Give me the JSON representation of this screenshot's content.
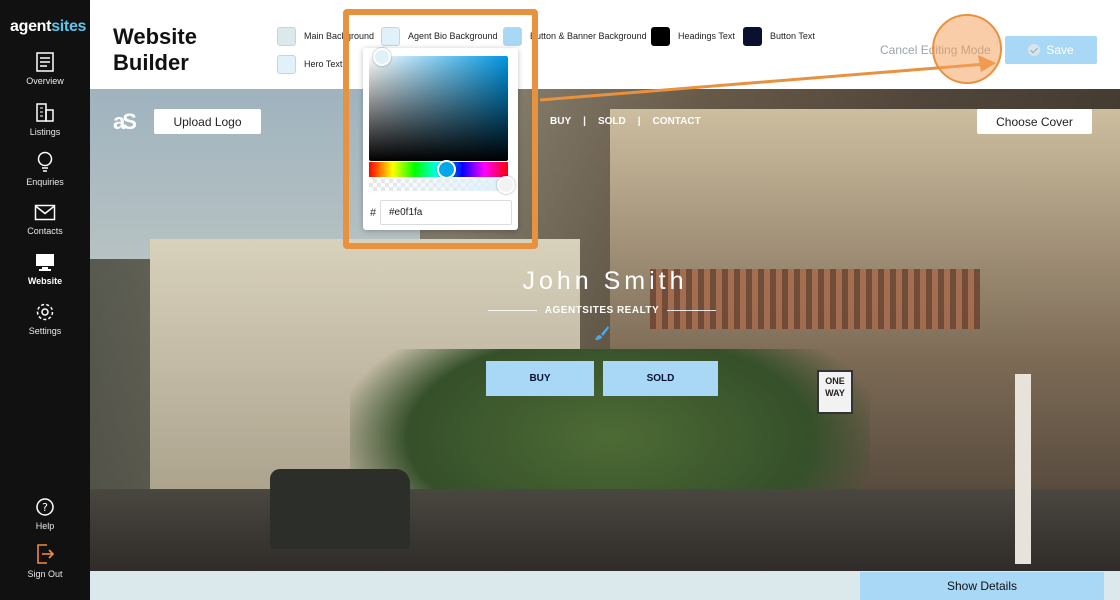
{
  "brand": {
    "part1": "agent",
    "part2": "sites"
  },
  "sidebar": {
    "items": [
      {
        "label": "Overview"
      },
      {
        "label": "Listings"
      },
      {
        "label": "Enquiries"
      },
      {
        "label": "Contacts"
      },
      {
        "label": "Website"
      },
      {
        "label": "Settings"
      }
    ],
    "bottom": [
      {
        "label": "Help"
      },
      {
        "label": "Sign Out"
      }
    ]
  },
  "header": {
    "title": "Website Builder",
    "swatches": [
      {
        "label": "Main Background",
        "color": "#dce9ec"
      },
      {
        "label": "Agent Bio Background",
        "color": "#e0f1fa"
      },
      {
        "label": "Button & Banner Background",
        "color": "#a8d8f6"
      },
      {
        "label": "Headings Text",
        "color": "#000000"
      },
      {
        "label": "Button Text",
        "color": "#0b1030"
      },
      {
        "label": "Hero Text",
        "color": "#e0f1fa"
      }
    ],
    "cancel_label": "Cancel Editing Mode",
    "save_label": "Save"
  },
  "picker": {
    "hash": "#",
    "hex_value": "#e0f1fa"
  },
  "hero": {
    "logo_text": "aS",
    "upload_logo_label": "Upload Logo",
    "choose_cover_label": "Choose Cover",
    "nav": [
      "BUY",
      "SOLD",
      "CONTACT"
    ],
    "nav_sep": "|",
    "agent_name": "John Smith",
    "agency": "AGENTSITES REALTY",
    "buy_label": "BUY",
    "sold_label": "SOLD",
    "sign_text": "ONE WAY"
  },
  "footer": {
    "show_details_label": "Show Details"
  },
  "colors": {
    "accent": "#a8d8f6",
    "highlight": "#e8913e",
    "sidebar_bg": "#111111"
  }
}
